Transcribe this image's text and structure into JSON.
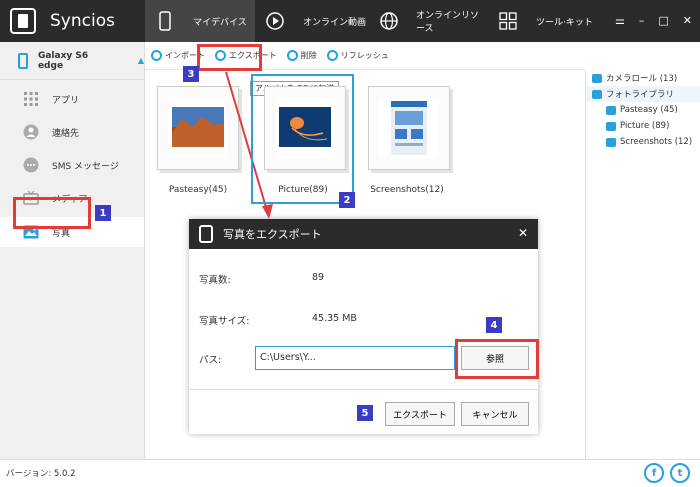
{
  "app": {
    "name": "Syncios"
  },
  "nav": [
    {
      "label": "マイデバイス",
      "icon": "phone-icon"
    },
    {
      "label": "オンライン動画",
      "icon": "play-icon"
    },
    {
      "label": "オンラインリソース",
      "icon": "globe-icon"
    },
    {
      "label": "ツール·キット",
      "icon": "grid-icon"
    }
  ],
  "window_controls": {
    "menu": "⚌",
    "minimize": "–",
    "maximize": "□",
    "close": "✕"
  },
  "device": {
    "name": "Galaxy S6 edge"
  },
  "sidebar": {
    "items": [
      {
        "label": "アプリ",
        "icon": "apps-grid-icon"
      },
      {
        "label": "連絡先",
        "icon": "contact-icon"
      },
      {
        "label": "SMS メッセージ",
        "icon": "sms-icon"
      },
      {
        "label": "メディア",
        "icon": "media-icon"
      },
      {
        "label": "写真",
        "icon": "photo-icon"
      }
    ]
  },
  "toolbar": {
    "import": "インポート",
    "export": "エクスポート",
    "delete": "削除",
    "refresh": "リフレッシュ"
  },
  "tooltip": "アルバムを PC に転送",
  "albums": [
    {
      "label": "Pasteasy(45)"
    },
    {
      "label": "Picture(89)"
    },
    {
      "label": "Screenshots(12)"
    }
  ],
  "right_panel": {
    "camera_roll": "カメラロール (13)",
    "photo_library": "フォトライブラリ",
    "children": [
      "Pasteasy (45)",
      "Picture (89)",
      "Screenshots (12)"
    ]
  },
  "dialog": {
    "title": "写真をエクスポート",
    "count_label": "写真数:",
    "count_value": "89",
    "size_label": "写真サイズ:",
    "size_value": "45.35 MB",
    "path_label": "パス:",
    "path_value": "C:\\Users\\Y...",
    "browse_button": "参照",
    "export_button": "エクスポート",
    "cancel_button": "キャンセル"
  },
  "steps": [
    "1",
    "2",
    "3",
    "4",
    "5"
  ],
  "status": {
    "version": "バージョン: 5.0.2"
  },
  "colors": {
    "accent": "#29a0dc",
    "annotation_red": "#e43a3a",
    "step_badge": "#3b3bc4",
    "topbar": "#2b2b2b"
  }
}
